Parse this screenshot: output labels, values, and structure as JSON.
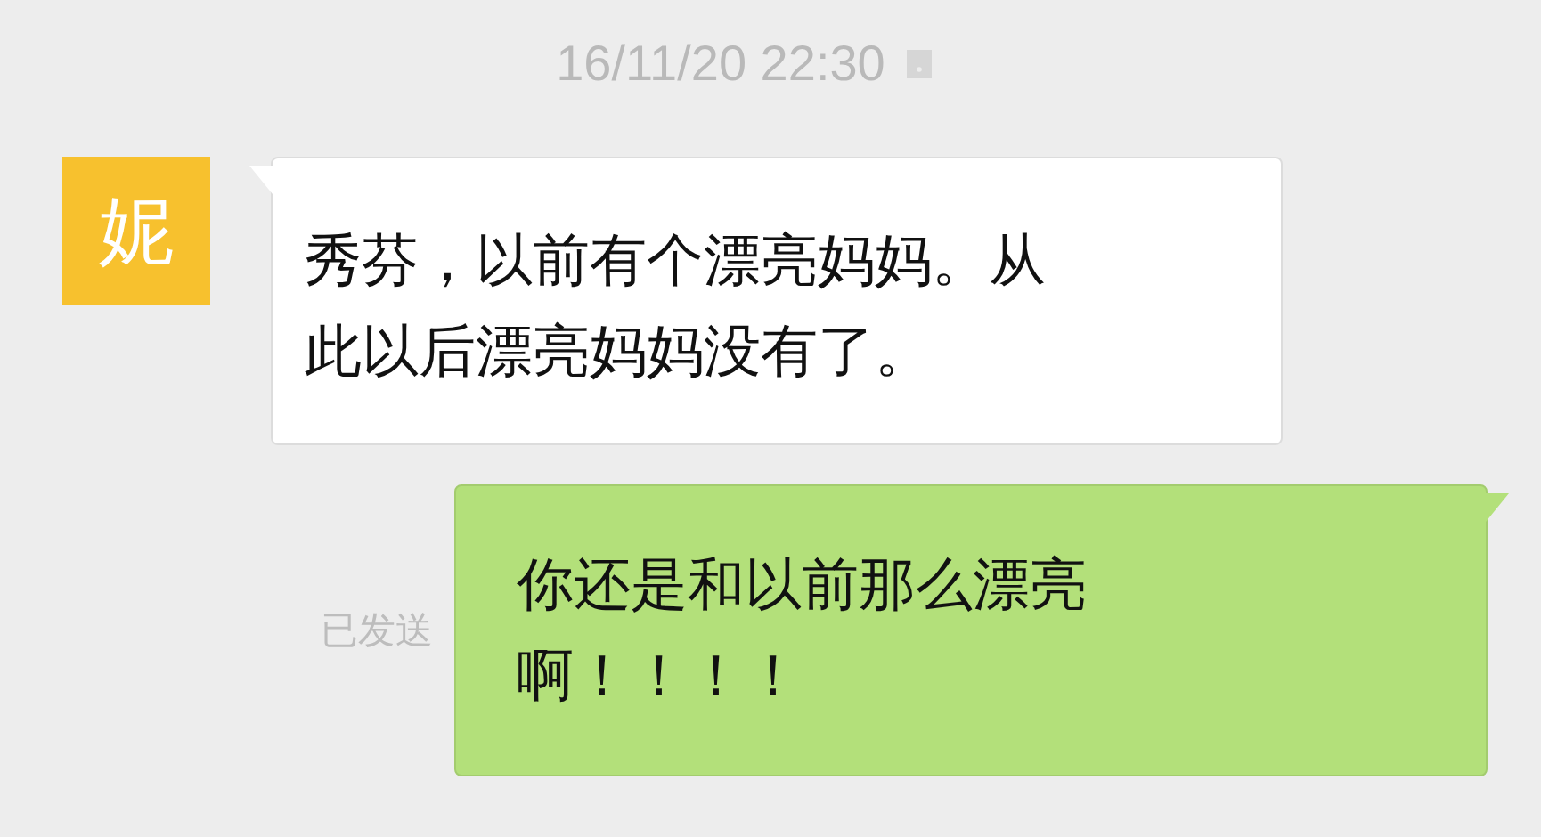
{
  "timestamp": "16/11/20 22:30",
  "messages": [
    {
      "kind": "incoming",
      "avatar": "妮",
      "lines": [
        "秀芬，以前有个漂亮妈妈。从",
        "此以后漂亮妈妈没有了。"
      ]
    },
    {
      "kind": "outgoing",
      "status": "已发送",
      "lines": [
        "你还是和以前那么漂亮",
        "啊！！！！"
      ]
    }
  ]
}
